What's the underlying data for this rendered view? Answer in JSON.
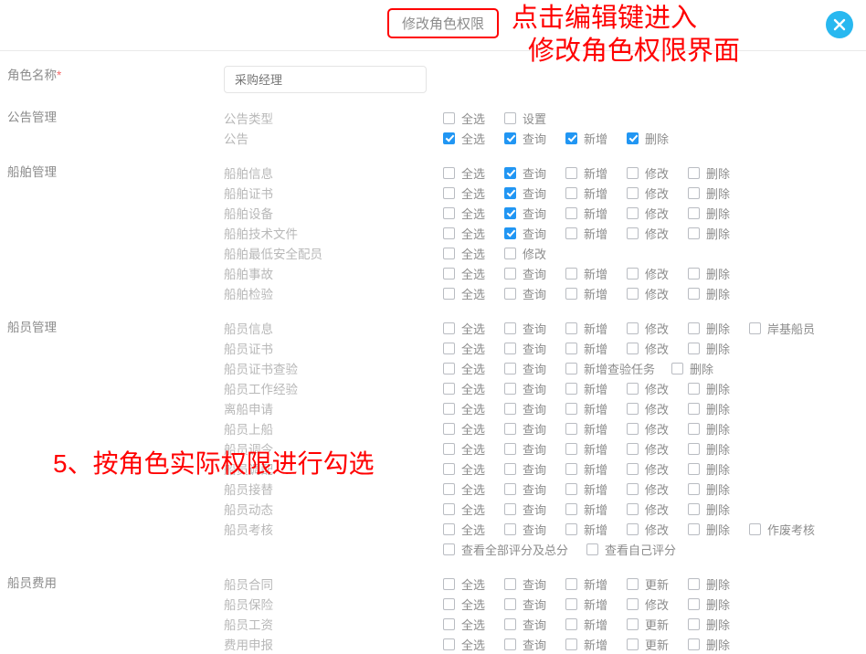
{
  "dialog": {
    "title": "修改角色权限",
    "close_icon": "close-circle-icon",
    "annotation_top_line1": "点击编辑键进入",
    "annotation_top_line2": "修改角色权限界面",
    "annotation_left": "5、按角色实际权限进行勾选",
    "accent_color": "#28b8f0",
    "annotation_color": "#ff0000",
    "checked_color": "#2196f3"
  },
  "form": {
    "role_name_label": "角色名称",
    "required_mark": "*",
    "role_name_value": "采购经理",
    "role_name_placeholder": "采购经理"
  },
  "sections": [
    {
      "label": "公告管理",
      "rows": [
        {
          "name": "公告类型",
          "checks": [
            {
              "label": "全选",
              "checked": false
            },
            {
              "label": "设置",
              "checked": false
            }
          ]
        },
        {
          "name": "公告",
          "checks": [
            {
              "label": "全选",
              "checked": true
            },
            {
              "label": "查询",
              "checked": true
            },
            {
              "label": "新增",
              "checked": true
            },
            {
              "label": "删除",
              "checked": true
            }
          ]
        }
      ]
    },
    {
      "label": "船舶管理",
      "rows": [
        {
          "name": "船舶信息",
          "checks": [
            {
              "label": "全选",
              "checked": false
            },
            {
              "label": "查询",
              "checked": true
            },
            {
              "label": "新增",
              "checked": false
            },
            {
              "label": "修改",
              "checked": false
            },
            {
              "label": "删除",
              "checked": false
            }
          ]
        },
        {
          "name": "船舶证书",
          "checks": [
            {
              "label": "全选",
              "checked": false
            },
            {
              "label": "查询",
              "checked": true
            },
            {
              "label": "新增",
              "checked": false
            },
            {
              "label": "修改",
              "checked": false
            },
            {
              "label": "删除",
              "checked": false
            }
          ]
        },
        {
          "name": "船舶设备",
          "checks": [
            {
              "label": "全选",
              "checked": false
            },
            {
              "label": "查询",
              "checked": true
            },
            {
              "label": "新增",
              "checked": false
            },
            {
              "label": "修改",
              "checked": false
            },
            {
              "label": "删除",
              "checked": false
            }
          ]
        },
        {
          "name": "船舶技术文件",
          "checks": [
            {
              "label": "全选",
              "checked": false
            },
            {
              "label": "查询",
              "checked": true
            },
            {
              "label": "新增",
              "checked": false
            },
            {
              "label": "修改",
              "checked": false
            },
            {
              "label": "删除",
              "checked": false
            }
          ]
        },
        {
          "name": "船舶最低安全配员",
          "checks": [
            {
              "label": "全选",
              "checked": false
            },
            {
              "label": "修改",
              "checked": false
            }
          ]
        },
        {
          "name": "船舶事故",
          "checks": [
            {
              "label": "全选",
              "checked": false
            },
            {
              "label": "查询",
              "checked": false
            },
            {
              "label": "新增",
              "checked": false
            },
            {
              "label": "修改",
              "checked": false
            },
            {
              "label": "删除",
              "checked": false
            }
          ]
        },
        {
          "name": "船舶检验",
          "checks": [
            {
              "label": "全选",
              "checked": false
            },
            {
              "label": "查询",
              "checked": false
            },
            {
              "label": "新增",
              "checked": false
            },
            {
              "label": "修改",
              "checked": false
            },
            {
              "label": "删除",
              "checked": false
            }
          ]
        }
      ]
    },
    {
      "label": "船员管理",
      "rows": [
        {
          "name": "船员信息",
          "checks": [
            {
              "label": "全选",
              "checked": false
            },
            {
              "label": "查询",
              "checked": false
            },
            {
              "label": "新增",
              "checked": false
            },
            {
              "label": "修改",
              "checked": false
            },
            {
              "label": "删除",
              "checked": false
            },
            {
              "label": "岸基船员",
              "checked": false,
              "wide": true
            }
          ]
        },
        {
          "name": "船员证书",
          "checks": [
            {
              "label": "全选",
              "checked": false
            },
            {
              "label": "查询",
              "checked": false
            },
            {
              "label": "新增",
              "checked": false
            },
            {
              "label": "修改",
              "checked": false
            },
            {
              "label": "删除",
              "checked": false
            }
          ]
        },
        {
          "name": "船员证书查验",
          "checks": [
            {
              "label": "全选",
              "checked": false
            },
            {
              "label": "查询",
              "checked": false
            },
            {
              "label": "新增查验任务",
              "checked": false,
              "wide": true
            },
            {
              "label": "删除",
              "checked": false,
              "wide": true
            }
          ]
        },
        {
          "name": "船员工作经验",
          "checks": [
            {
              "label": "全选",
              "checked": false
            },
            {
              "label": "查询",
              "checked": false
            },
            {
              "label": "新增",
              "checked": false
            },
            {
              "label": "修改",
              "checked": false
            },
            {
              "label": "删除",
              "checked": false
            }
          ]
        },
        {
          "name": "离船申请",
          "checks": [
            {
              "label": "全选",
              "checked": false
            },
            {
              "label": "查询",
              "checked": false
            },
            {
              "label": "新增",
              "checked": false
            },
            {
              "label": "修改",
              "checked": false
            },
            {
              "label": "删除",
              "checked": false
            }
          ]
        },
        {
          "name": "船员上船",
          "checks": [
            {
              "label": "全选",
              "checked": false
            },
            {
              "label": "查询",
              "checked": false
            },
            {
              "label": "新增",
              "checked": false
            },
            {
              "label": "修改",
              "checked": false
            },
            {
              "label": "删除",
              "checked": false
            }
          ]
        },
        {
          "name": "船员调令",
          "checks": [
            {
              "label": "全选",
              "checked": false
            },
            {
              "label": "查询",
              "checked": false
            },
            {
              "label": "新增",
              "checked": false
            },
            {
              "label": "修改",
              "checked": false
            },
            {
              "label": "删除",
              "checked": false
            }
          ]
        },
        {
          "name": "船员调配",
          "checks": [
            {
              "label": "全选",
              "checked": false
            },
            {
              "label": "查询",
              "checked": false
            },
            {
              "label": "新增",
              "checked": false
            },
            {
              "label": "修改",
              "checked": false
            },
            {
              "label": "删除",
              "checked": false
            }
          ]
        },
        {
          "name": "船员接替",
          "checks": [
            {
              "label": "全选",
              "checked": false
            },
            {
              "label": "查询",
              "checked": false
            },
            {
              "label": "新增",
              "checked": false
            },
            {
              "label": "修改",
              "checked": false
            },
            {
              "label": "删除",
              "checked": false
            }
          ]
        },
        {
          "name": "船员动态",
          "checks": [
            {
              "label": "全选",
              "checked": false
            },
            {
              "label": "查询",
              "checked": false
            },
            {
              "label": "新增",
              "checked": false
            },
            {
              "label": "修改",
              "checked": false
            },
            {
              "label": "删除",
              "checked": false
            }
          ]
        },
        {
          "name": "船员考核",
          "checks": [
            {
              "label": "全选",
              "checked": false
            },
            {
              "label": "查询",
              "checked": false
            },
            {
              "label": "新增",
              "checked": false
            },
            {
              "label": "修改",
              "checked": false
            },
            {
              "label": "删除",
              "checked": false
            },
            {
              "label": "作废考核",
              "checked": false,
              "wide": true
            }
          ]
        },
        {
          "name": "",
          "indent": true,
          "checks": [
            {
              "label": "查看全部评分及总分",
              "checked": false,
              "xwide": true
            },
            {
              "label": "查看自己评分",
              "checked": false,
              "xwide": true
            }
          ]
        }
      ]
    },
    {
      "label": "船员费用",
      "rows": [
        {
          "name": "船员合同",
          "checks": [
            {
              "label": "全选",
              "checked": false
            },
            {
              "label": "查询",
              "checked": false
            },
            {
              "label": "新增",
              "checked": false
            },
            {
              "label": "更新",
              "checked": false
            },
            {
              "label": "删除",
              "checked": false
            }
          ]
        },
        {
          "name": "船员保险",
          "checks": [
            {
              "label": "全选",
              "checked": false
            },
            {
              "label": "查询",
              "checked": false
            },
            {
              "label": "新增",
              "checked": false
            },
            {
              "label": "修改",
              "checked": false
            },
            {
              "label": "删除",
              "checked": false
            }
          ]
        },
        {
          "name": "船员工资",
          "checks": [
            {
              "label": "全选",
              "checked": false
            },
            {
              "label": "查询",
              "checked": false
            },
            {
              "label": "新增",
              "checked": false
            },
            {
              "label": "更新",
              "checked": false
            },
            {
              "label": "删除",
              "checked": false
            }
          ]
        },
        {
          "name": "费用申报",
          "checks": [
            {
              "label": "全选",
              "checked": false
            },
            {
              "label": "查询",
              "checked": false
            },
            {
              "label": "新增",
              "checked": false
            },
            {
              "label": "更新",
              "checked": false
            },
            {
              "label": "删除",
              "checked": false
            }
          ]
        }
      ]
    }
  ]
}
